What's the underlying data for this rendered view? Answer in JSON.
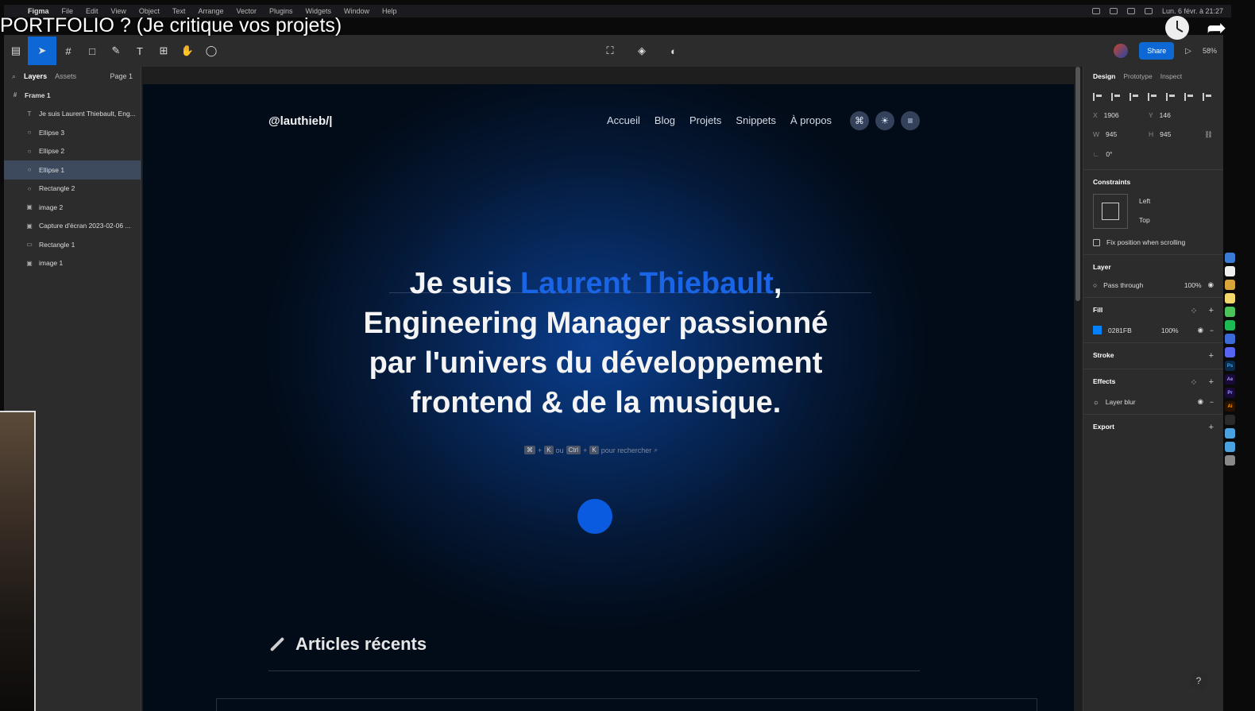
{
  "video": {
    "title": "PORTFOLIO ? (Je critique vos projets)"
  },
  "menubar": {
    "items": [
      "Figma",
      "File",
      "Edit",
      "View",
      "Object",
      "Text",
      "Arrange",
      "Vector",
      "Plugins",
      "Widgets",
      "Window",
      "Help"
    ],
    "datetime": "Lun. 6 févr. à 21:27"
  },
  "toolbar": {
    "share_label": "Share",
    "zoom": "58%"
  },
  "layers_panel": {
    "tab_layers": "Layers",
    "tab_assets": "Assets",
    "page": "Page 1",
    "frame": "Frame 1",
    "layers": [
      {
        "label": "Je suis Laurent Thiebault, Eng...",
        "icon": "T"
      },
      {
        "label": "Ellipse 3",
        "icon": "○"
      },
      {
        "label": "Ellipse 2",
        "icon": "○"
      },
      {
        "label": "Ellipse 1",
        "icon": "○"
      },
      {
        "label": "Rectangle 2",
        "icon": "○"
      },
      {
        "label": "image 2",
        "icon": "▣"
      },
      {
        "label": "Capture d'écran 2023-02-06 ...",
        "icon": "▣"
      },
      {
        "label": "Rectangle 1",
        "icon": "▭"
      },
      {
        "label": "image 1",
        "icon": "▣"
      }
    ]
  },
  "site": {
    "logo": "@lauthieb/|",
    "nav": [
      "Accueil",
      "Blog",
      "Projets",
      "Snippets",
      "À propos"
    ],
    "nav_icons": [
      "⌘",
      "☀",
      "≡"
    ],
    "hero_prefix": "Je suis ",
    "hero_name": "Laurent Thiebault",
    "hero_suffix": ",",
    "hero_line2": "Engineering Manager passionné",
    "hero_line3": "par l'univers du développement",
    "hero_line4": "frontend & de la musique.",
    "kbd_cmd": "⌘",
    "kbd_plus": "+",
    "kbd_k": "K",
    "kbd_or": "ou",
    "kbd_ctrl": "Ctrl",
    "kbd_suffix": "pour rechercher",
    "articles_heading": "Articles récents"
  },
  "design_panel": {
    "tab_design": "Design",
    "tab_prototype": "Prototype",
    "tab_inspect": "Inspect",
    "x": "1906",
    "y": "146",
    "w": "945",
    "h": "945",
    "rotation": "0°",
    "constraints_title": "Constraints",
    "constraint_h": "Left",
    "constraint_v": "Top",
    "fix_position": "Fix position when scrolling",
    "layer_title": "Layer",
    "blend_mode": "Pass through",
    "layer_opacity": "100%",
    "fill_title": "Fill",
    "fill_hex": "0281FB",
    "fill_color": "#0281fb",
    "fill_opacity": "100%",
    "stroke_title": "Stroke",
    "effects_title": "Effects",
    "effect_name": "Layer blur",
    "export_title": "Export"
  },
  "colors": {
    "accent": "#0d68d6",
    "hero_highlight": "#1a64e6",
    "dot": "#0a5be0"
  }
}
